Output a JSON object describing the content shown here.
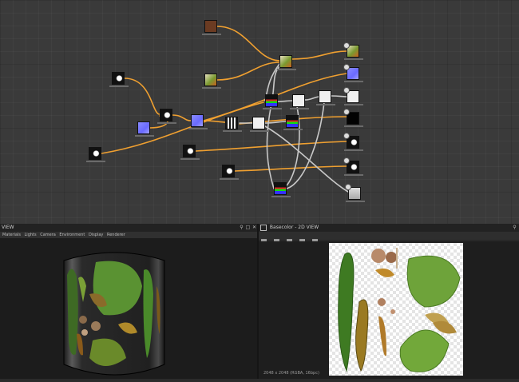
{
  "left_panel": {
    "title": "VIEW",
    "menu": [
      "Materials",
      "Lights",
      "Camera",
      "Environment",
      "Display",
      "Renderer"
    ]
  },
  "right_panel": {
    "title": "Basecolor - 2D VIEW",
    "texture_info": "2048 x 2048 (RGBA, 16bpc)"
  },
  "icons": {
    "pin": "pin-icon",
    "maximize": "maximize-icon",
    "close": "close-icon",
    "view2d": "2d-view-icon"
  },
  "colors": {
    "wire_orange": "#f0a030",
    "wire_gray": "#c8c8c8",
    "graph_bg": "#3a3a3a"
  }
}
